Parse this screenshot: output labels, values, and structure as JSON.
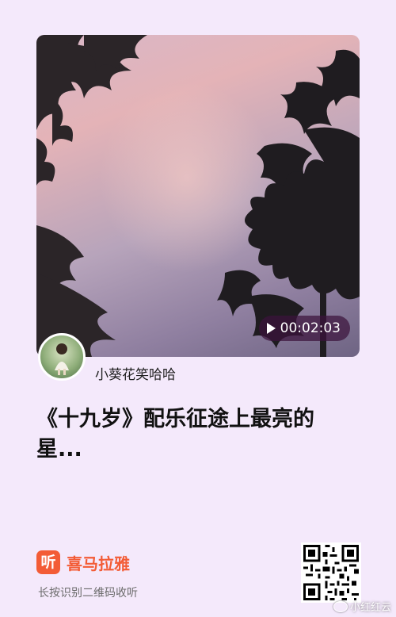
{
  "media": {
    "duration": "00:02:03",
    "play_icon": "play-icon"
  },
  "uploader": {
    "name": "小葵花笑哈哈"
  },
  "track": {
    "title": "《十九岁》配乐征途上最亮的星..."
  },
  "brand": {
    "icon_glyph": "听",
    "name": "喜马拉雅",
    "color": "#f35c36"
  },
  "footer": {
    "scan_hint": "长按识别二维码收听"
  },
  "watermark": {
    "text": "小红红云"
  },
  "colors": {
    "background": "#f4e9fb",
    "duration_pill": "#3c143c"
  }
}
